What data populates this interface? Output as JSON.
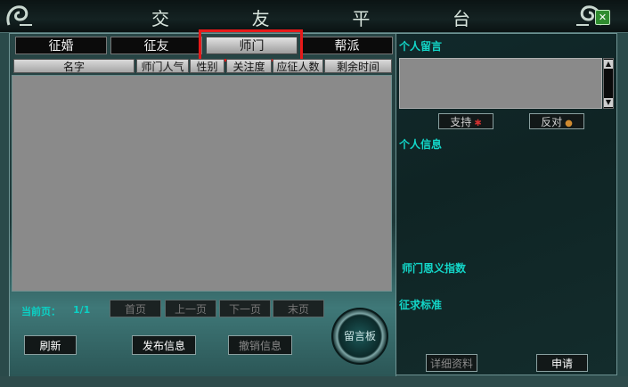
{
  "window": {
    "title_chars": [
      "交",
      "友",
      "平",
      "台"
    ],
    "close_label": "✕"
  },
  "tabs": [
    {
      "label": "征婚",
      "active": false
    },
    {
      "label": "征友",
      "active": false
    },
    {
      "label": "师门",
      "active": true
    },
    {
      "label": "帮派",
      "active": false
    }
  ],
  "columns": [
    "名字",
    "师门人气",
    "性别",
    "关注度",
    "应征人数",
    "剩余时间"
  ],
  "pagination": {
    "label": "当前页：",
    "value": "1/1",
    "buttons": [
      "首页",
      "上一页",
      "下一页",
      "末页"
    ]
  },
  "actions": {
    "refresh": "刷新",
    "publish": "发布信息",
    "withdraw": "撤销信息"
  },
  "board": {
    "label": "留言板"
  },
  "right_panel": {
    "personal_message": "个人留言",
    "support": "支持",
    "oppose": "反对",
    "personal_info": "个人信息",
    "mentor_index": "师门恩义指数",
    "criteria": "征求标准",
    "details": "详细资料",
    "apply": "申请"
  },
  "colors": {
    "accent_text": "#13d6c8",
    "highlight": "#e81919"
  }
}
